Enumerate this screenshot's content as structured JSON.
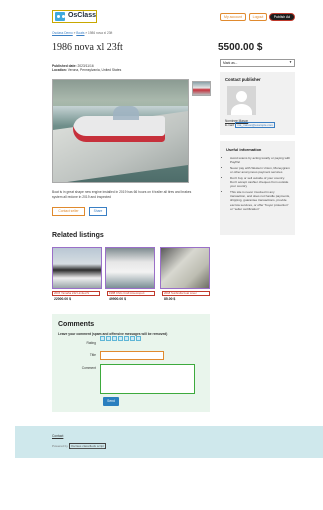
{
  "header": {
    "logo_text": "OsClass",
    "my_account": "My account",
    "logout": "Logout",
    "publish_ad": "Publish Ad"
  },
  "breadcrumb": {
    "home": "Osclass Demo",
    "category": "Boats",
    "current": "» 1986 nova xl 23ft"
  },
  "listing": {
    "title": "1986 nova xl 23ft",
    "price": "5500.00 $",
    "published_label": "Published date:",
    "published_value": "2023/11/16",
    "location_label": "Location:",
    "location_value": "Verona, Pennsylvania, United States",
    "description": "Boat is in great shape new engine installed in 2019 has 66 hours on it trailer all tires and brakes system all redone in 2019 and inspected",
    "contact_seller": "Contact seller",
    "share": "Share"
  },
  "mark_as": {
    "selected": "Mark as..."
  },
  "publisher": {
    "heading": "Contact publisher",
    "name": "Nominee Mason",
    "email_label": "E-mail:",
    "email_value": "ma_mason@example.com"
  },
  "useful_info": {
    "heading": "Useful information",
    "items": [
      "Avoid scams by acting locally or paying with PayPal",
      "Never pay with Western Union, Moneygram or other anonymous payment services",
      "Don't buy or sell outside of your country. Don't accept cashier cheques from outside your country",
      "This site is never involved in any transaction, and does not handle payments, shipping, guarantee transactions, provide escrow services, or offer \"buyer protection\" or \"seller certification\""
    ]
  },
  "related": {
    "heading": "Related listings",
    "items": [
      {
        "name": "2015 Yamaha 242 Limited S",
        "price": "22000.00 $"
      },
      {
        "name": "1988 Chris Craft Amerosport",
        "price": "49900.00 $"
      },
      {
        "name": "2018 Sunbrella boat cover",
        "price": "85.00 $"
      }
    ]
  },
  "comments": {
    "heading": "Comments",
    "hint": "Leave your comment (spam and offensive messages will be removed)",
    "rating_label": "Rating",
    "title_label": "Title",
    "comment_label": "Comment",
    "send": "Send"
  },
  "footer": {
    "contact": "Contact",
    "powered_prefix": "Powered by",
    "powered_link": "Osclass classifieds script"
  },
  "colors": {
    "accent_orange": "#e08a2e",
    "link_blue": "#3a7fc4",
    "send_blue": "#2a7fbf",
    "footer_bg": "#cfe8ec",
    "comments_bg": "#e9f5ec"
  }
}
